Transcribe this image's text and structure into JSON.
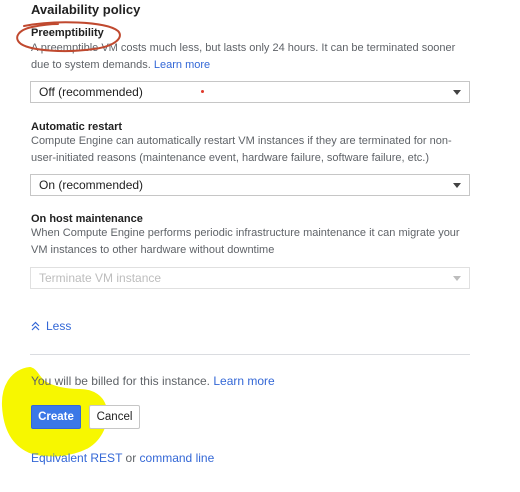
{
  "availability_policy": {
    "title": "Availability policy"
  },
  "preemptibility": {
    "heading": "Preemptibility",
    "description_line1": "A preemptible VM costs much less, but lasts only 24 hours. It can be terminated sooner",
    "description_line2": "due to system demands.",
    "learn_more": "Learn more",
    "selected_value": "Off (recommended)"
  },
  "automatic_restart": {
    "heading": "Automatic restart",
    "description_line1": "Compute Engine can automatically restart VM instances if they are terminated for non-",
    "description_line2": "user-initiated reasons (maintenance event, hardware failure, software failure, etc.)",
    "selected_value": "On (recommended)"
  },
  "host_maintenance": {
    "heading": "On host maintenance",
    "description_line1": "When Compute Engine performs periodic infrastructure maintenance it can migrate your",
    "description_line2": "VM instances to other hardware without downtime",
    "selected_value": "Terminate VM instance"
  },
  "less_toggle": {
    "icon": "chevron-up-double",
    "label": "Less"
  },
  "billing": {
    "text": "You will be billed for this instance.",
    "learn_more": "Learn more"
  },
  "actions": {
    "create_label": "Create",
    "cancel_label": "Cancel"
  },
  "equivalent": {
    "prefix": "Equivalent",
    "rest": "REST",
    "or": "or",
    "command_line": "command line"
  },
  "colors": {
    "primary": "#3b78e7",
    "link": "#3367d6",
    "annotation_red": "#c0492f",
    "annotation_yellow": "#f7f700"
  }
}
